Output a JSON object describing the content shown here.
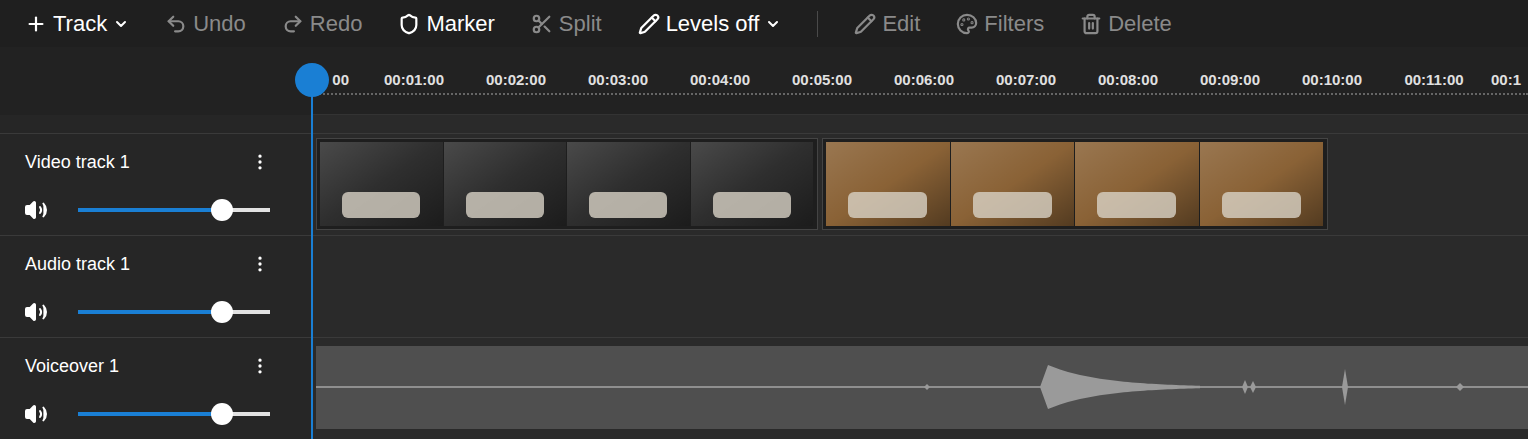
{
  "toolbar": {
    "groups": [
      [
        {
          "label": "Track",
          "disabled": false,
          "dropdown": true
        },
        {
          "label": "Undo",
          "disabled": true,
          "dropdown": false
        },
        {
          "label": "Redo",
          "disabled": true,
          "dropdown": false
        },
        {
          "label": "Marker",
          "disabled": false,
          "dropdown": false
        },
        {
          "label": "Split",
          "disabled": true,
          "dropdown": false
        },
        {
          "label": "Levels off",
          "disabled": false,
          "dropdown": true
        }
      ],
      [
        {
          "label": "Edit",
          "disabled": true,
          "dropdown": false
        },
        {
          "label": "Filters",
          "disabled": true,
          "dropdown": false
        },
        {
          "label": "Delete",
          "disabled": true,
          "dropdown": false
        }
      ]
    ]
  },
  "ruler": {
    "ticks": [
      "00",
      "00:01:00",
      "00:02:00",
      "00:03:00",
      "00:04:00",
      "00:05:00",
      "00:06:00",
      "00:07:00",
      "00:08:00",
      "00:09:00",
      "00:10:00",
      "00:11:00",
      "00:1"
    ]
  },
  "tracks": [
    {
      "name": "Video track 1",
      "kind": "video",
      "muted": false,
      "level": 0.75,
      "clips": [
        {
          "color": "#2e2e2e"
        },
        {
          "color": "#8a6236"
        }
      ]
    },
    {
      "name": "Audio track 1",
      "kind": "audio",
      "muted": false,
      "level": 0.75,
      "clips": []
    },
    {
      "name": "Voiceover 1",
      "kind": "voiceover",
      "muted": false,
      "level": 0.75,
      "clips": [
        {
          "color": "#4f4f4f"
        }
      ]
    }
  ]
}
